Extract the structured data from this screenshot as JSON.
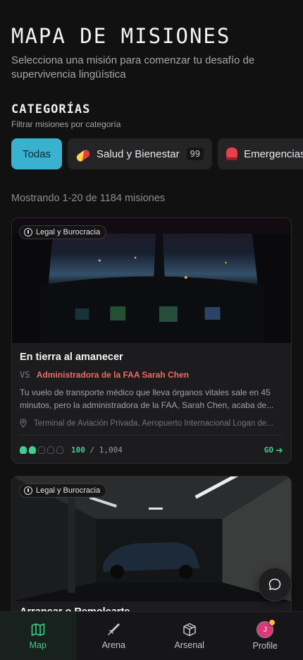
{
  "header": {
    "title": "MAPA DE MISIONES",
    "subtitle": "Selecciona una misión para comenzar tu desafío de supervivencia lingüística"
  },
  "categories": {
    "title": "CATEGORÍAS",
    "subtitle": "Filtrar misiones por categoría",
    "chips": [
      {
        "label": "Todas",
        "active": true
      },
      {
        "label": "Salud y Bienestar",
        "count": "99",
        "icon": "pill-icon"
      },
      {
        "label": "Emergencias",
        "icon": "siren-icon"
      }
    ]
  },
  "results": {
    "showing": "Mostrando 1-20 de 1184 misiones"
  },
  "missions": [
    {
      "tag": "Legal y Burocracia",
      "title": "En tierra al amanecer",
      "vs": "VS",
      "opponent": "Administradora de la FAA Sarah Chen",
      "description": "Tu vuelo de transporte médico que lleva órganos vitales sale en 45 minutos, pero la administradora de la FAA, Sarah Chen, acaba de...",
      "location": "Terminal de Aviación Privada, Aeropuerto Internacional Logan de...",
      "difficulty_filled": 2,
      "difficulty_total": 5,
      "xp_current": "100",
      "xp_sep": "/",
      "xp_total": "1,004",
      "go": "GO",
      "hero_icon": "cockpit-scene"
    },
    {
      "tag": "Legal y Burocracia",
      "title": "Arrancar o Remolcarte",
      "hero_icon": "parking-garage-scene"
    }
  ],
  "nav": {
    "items": [
      {
        "label": "Map",
        "icon": "map-icon",
        "active": true
      },
      {
        "label": "Arena",
        "icon": "sword-icon"
      },
      {
        "label": "Arsenal",
        "icon": "box-icon"
      },
      {
        "label": "Profile",
        "icon": "avatar",
        "avatar_letter": "J"
      }
    ]
  },
  "colors": {
    "accent": "#39b2d0",
    "success": "#3ed08e",
    "opponent": "#ee6b62",
    "background": "#111112",
    "card": "#1c1c1e"
  }
}
